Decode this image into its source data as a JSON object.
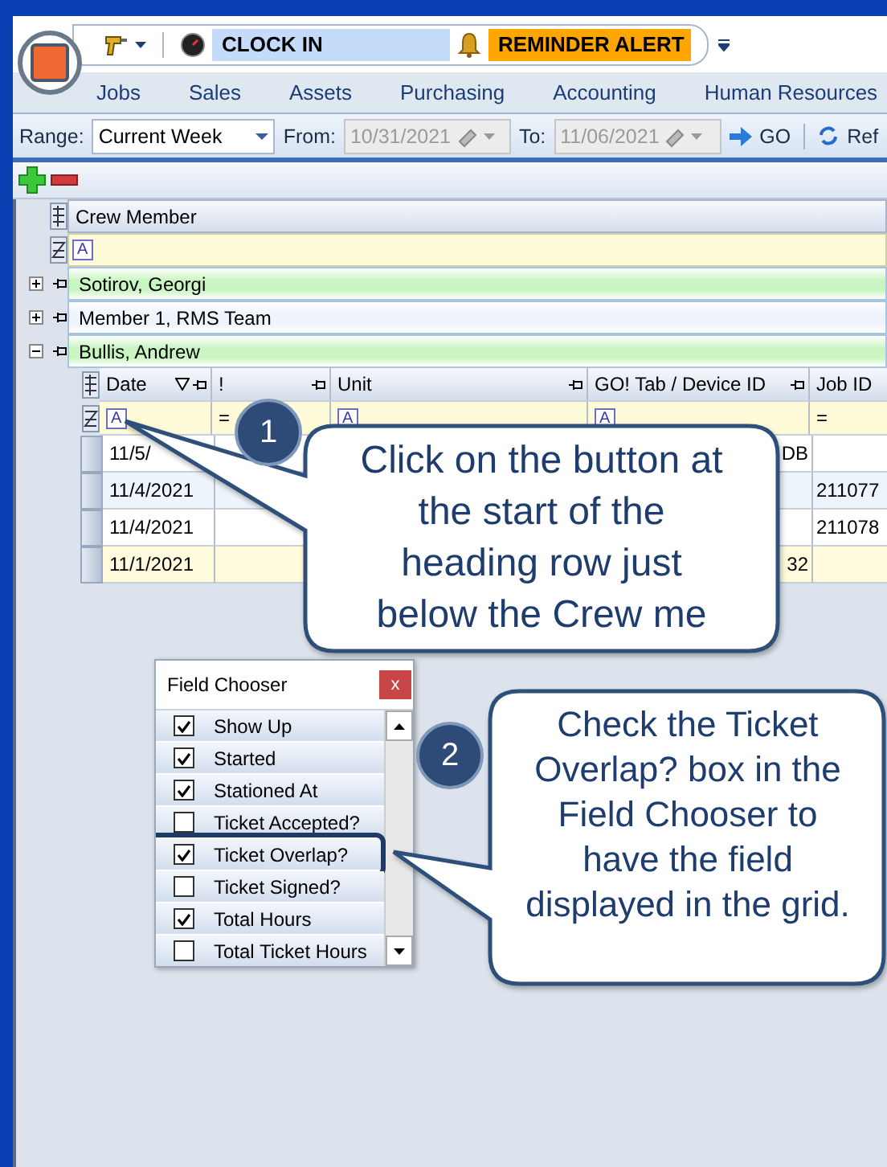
{
  "quick_access": {
    "clock_in": "CLOCK IN",
    "reminder": "REMINDER ALERT"
  },
  "menu": [
    {
      "label": "Jobs"
    },
    {
      "label": "Sales"
    },
    {
      "label": "Assets"
    },
    {
      "label": "Purchasing"
    },
    {
      "label": "Accounting"
    },
    {
      "label": "Human Resources"
    }
  ],
  "toolbar": {
    "range_label": "Range:",
    "range_value": "Current Week",
    "from_label": "From:",
    "from_value": "10/31/2021",
    "to_label": "To:",
    "to_value": "11/06/2021",
    "go": "GO",
    "refresh": "Ref"
  },
  "grid": {
    "header": "Crew Member",
    "filter_symbol": "A",
    "groups": [
      {
        "name": "Sotirov, Georgi",
        "expanded": false,
        "color": "#c8f5c0"
      },
      {
        "name": "Member 1, RMS Team",
        "expanded": false,
        "color": "#eef4fc"
      },
      {
        "name": "Bullis, Andrew",
        "expanded": true,
        "color": "#c8f5c0"
      }
    ],
    "columns": [
      {
        "label": "Date",
        "sortable": true
      },
      {
        "label": "!",
        "sortable": false
      },
      {
        "label": "Unit",
        "sortable": false
      },
      {
        "label": "GO! Tab / Device ID",
        "sortable": false
      },
      {
        "label": "Job ID",
        "sortable": false
      }
    ],
    "filters": [
      {
        "kind": "text",
        "symbol": "A"
      },
      {
        "kind": "equals",
        "symbol": "="
      },
      {
        "kind": "text",
        "symbol": "A"
      },
      {
        "kind": "text",
        "symbol": "A"
      },
      {
        "kind": "equals",
        "symbol": "="
      }
    ],
    "rows": [
      {
        "color": "#ffffff",
        "cells": [
          "11/5/",
          "",
          "",
          "DB",
          ""
        ]
      },
      {
        "color": "#eef4fc",
        "cells": [
          "11/4/2021",
          "",
          "",
          "",
          "211077"
        ]
      },
      {
        "color": "#ffffff",
        "cells": [
          "11/4/2021",
          "",
          "",
          "",
          "211078"
        ]
      },
      {
        "color": "#fffbdc",
        "cells": [
          "11/1/2021",
          "",
          "",
          "32",
          ""
        ]
      }
    ]
  },
  "field_chooser": {
    "title": "Field Chooser",
    "close": "x",
    "items": [
      {
        "label": "Show Up",
        "checked": true,
        "highlighted": false
      },
      {
        "label": "Started",
        "checked": true,
        "highlighted": false
      },
      {
        "label": "Stationed At",
        "checked": true,
        "highlighted": false
      },
      {
        "label": "Ticket Accepted?",
        "checked": false,
        "highlighted": false
      },
      {
        "label": "Ticket Overlap?",
        "checked": true,
        "highlighted": true
      },
      {
        "label": "Ticket Signed?",
        "checked": false,
        "highlighted": false
      },
      {
        "label": "Total Hours",
        "checked": true,
        "highlighted": false
      },
      {
        "label": "Total Ticket Hours",
        "checked": false,
        "highlighted": false
      }
    ]
  },
  "callouts": [
    {
      "number": "1",
      "text": "Click on the button at the start of the heading row just below  the  Crew me"
    },
    {
      "number": "2",
      "text": "Check the Ticket Overlap? box in the Field Chooser to have the field displayed in the grid."
    }
  ]
}
